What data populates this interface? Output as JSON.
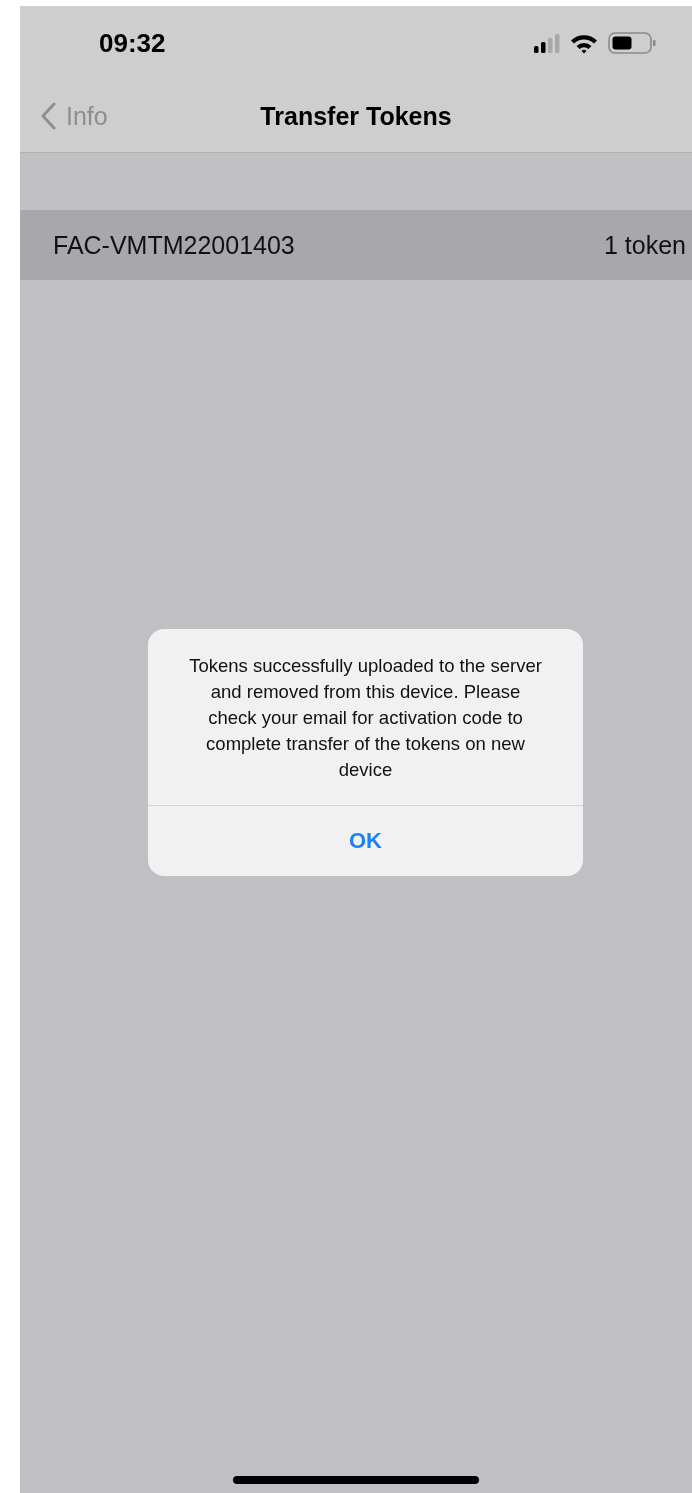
{
  "status_bar": {
    "time": "09:32"
  },
  "nav": {
    "back_label": "Info",
    "title": "Transfer Tokens"
  },
  "rows": [
    {
      "name": "FAC-VMTM22001403",
      "count": "1 token"
    }
  ],
  "alert": {
    "message": "Tokens successfully uploaded to the server and removed from this device. Please check your email for activation code to complete transfer of the tokens on new device",
    "button": "OK"
  }
}
